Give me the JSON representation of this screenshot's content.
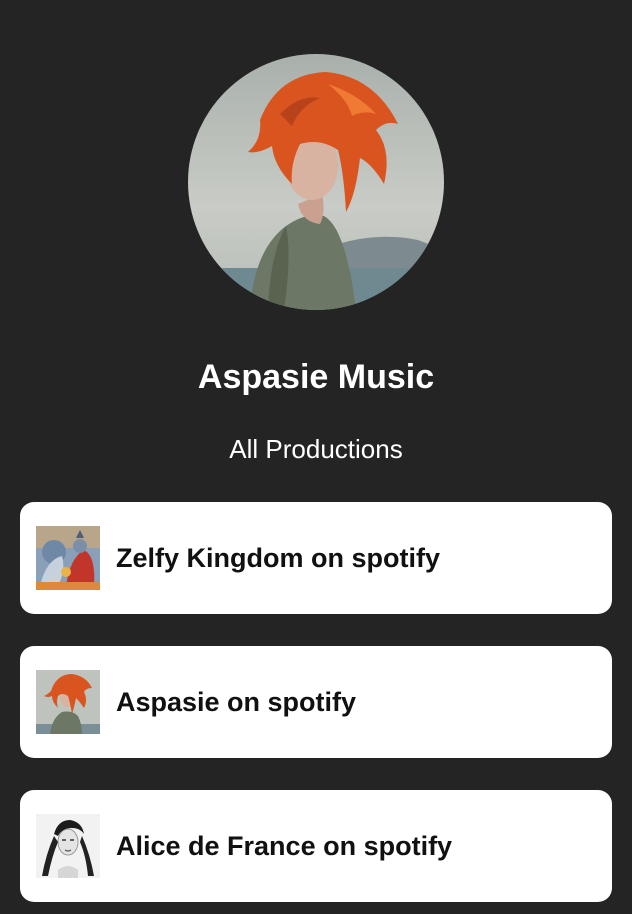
{
  "profile": {
    "name": "Aspasie Music",
    "avatar_icon": "portrait-photo-icon"
  },
  "section": {
    "title": "All Productions"
  },
  "links": [
    {
      "label": "Zelfy Kingdom on spotify",
      "thumbnail_icon": "fantasy-artwork-thumbnail-icon"
    },
    {
      "label": "Aspasie on spotify",
      "thumbnail_icon": "portrait-thumbnail-icon"
    },
    {
      "label": "Alice de France on spotify",
      "thumbnail_icon": "bw-portrait-thumbnail-icon"
    }
  ],
  "colors": {
    "background": "#242424",
    "card": "#ffffff",
    "text_light": "#ffffff",
    "text_dark": "#111111",
    "hair_orange": "#d9541e"
  }
}
